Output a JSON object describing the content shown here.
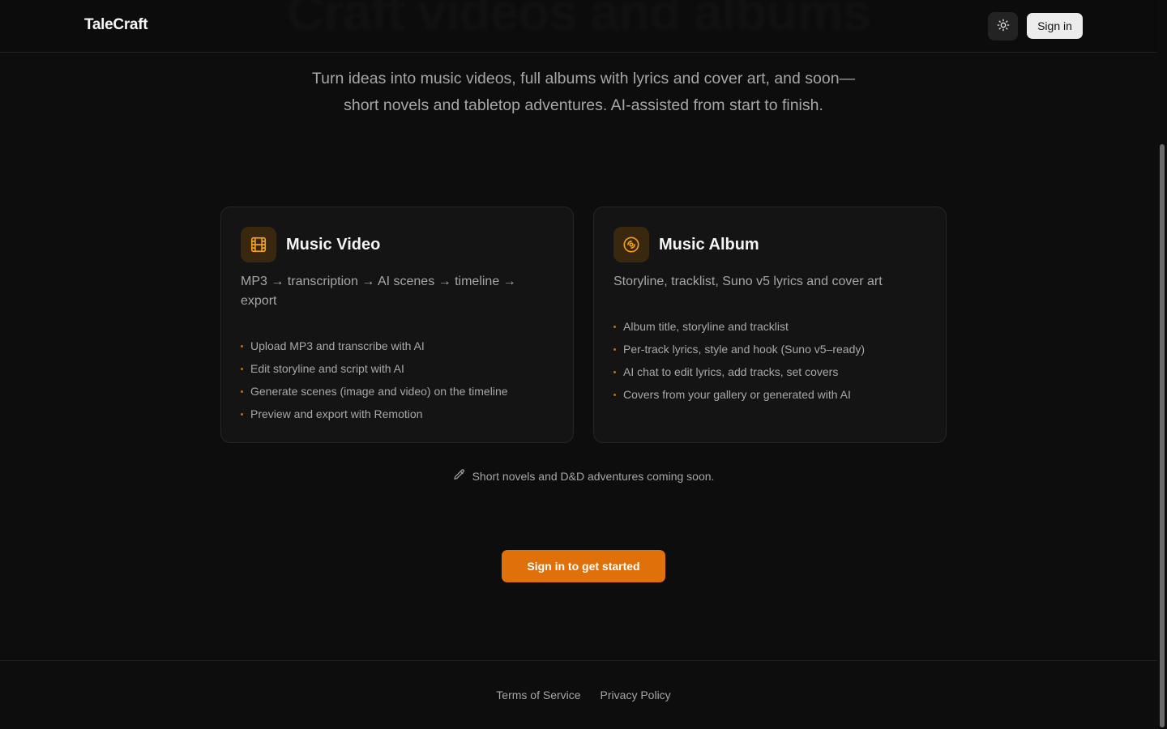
{
  "hero": {
    "title": "Craft videos and albums",
    "subtitle_line1": "Turn ideas into music videos, full albums with lyrics and cover art, and soon—",
    "subtitle_line2": "short novels and tabletop adventures. AI-assisted from start to finish."
  },
  "header": {
    "logo": "TaleCraft",
    "theme_icon": "sun-icon",
    "signin_label": "Sign in"
  },
  "cards": [
    {
      "icon": "film-icon",
      "title": "Music Video",
      "description": "MP3 → transcription → AI scenes → timeline → export",
      "features": [
        "Upload MP3 and transcribe with AI",
        "Edit storyline and script with AI",
        "Generate scenes (image and video) on the timeline",
        "Preview and export with Remotion"
      ]
    },
    {
      "icon": "disc-icon",
      "title": "Music Album",
      "description": "Storyline, tracklist, Suno v5 lyrics and cover art",
      "features": [
        "Album title, storyline and tracklist",
        "Per-track lyrics, style and hook (Suno v5–ready)",
        "AI chat to edit lyrics, add tracks, set covers",
        "Covers from your gallery or generated with AI"
      ]
    }
  ],
  "coming_soon": {
    "icon": "pencil-icon",
    "text": "Short novels and D&D adventures coming soon."
  },
  "cta": {
    "label": "Sign in to get started"
  },
  "footer": {
    "links": [
      "Terms of Service",
      "Privacy Policy"
    ]
  },
  "colors": {
    "background": "#0d0d0d",
    "card": "#141414",
    "accent": "#e0700a",
    "icon_bg": "#3a2710",
    "icon_stroke": "#f0a020"
  }
}
